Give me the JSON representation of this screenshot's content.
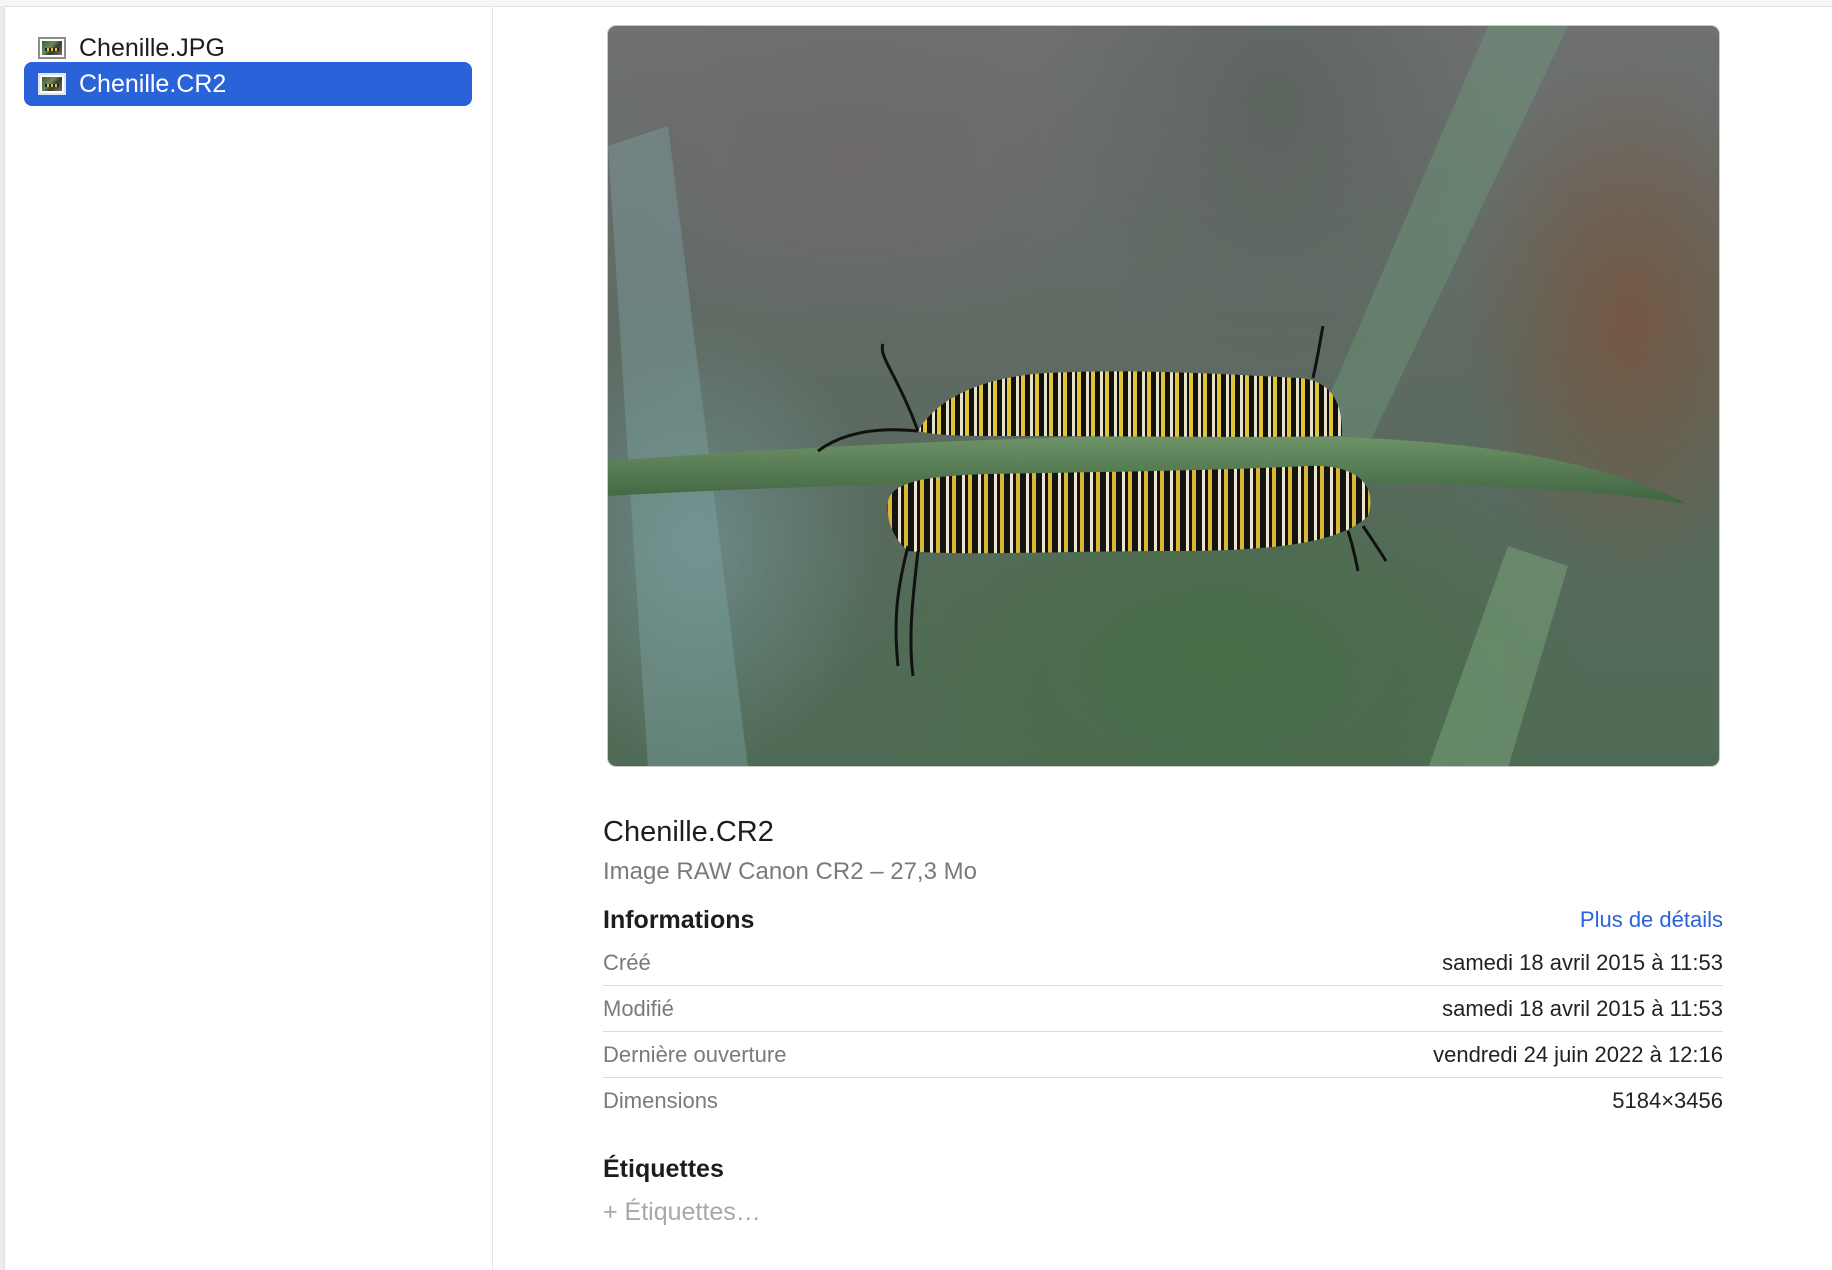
{
  "sidebar": {
    "files": [
      {
        "name": "Chenille.JPG",
        "selected": false,
        "icon": "image-file-icon"
      },
      {
        "name": "Chenille.CR2",
        "selected": true,
        "icon": "image-file-icon"
      }
    ]
  },
  "preview": {
    "file_name": "Chenille.CR2",
    "file_type_size": "Image RAW Canon CR2 – 27,3 Mo"
  },
  "info": {
    "title": "Informations",
    "more_link": "Plus de détails",
    "rows": [
      {
        "label": "Créé",
        "value": "samedi 18 avril 2015 à 11:53"
      },
      {
        "label": "Modifié",
        "value": "samedi 18 avril 2015 à 11:53"
      },
      {
        "label": "Dernière ouverture",
        "value": "vendredi 24 juin 2022 à 12:16"
      },
      {
        "label": "Dimensions",
        "value": "5184×3456"
      }
    ]
  },
  "tags": {
    "title": "Étiquettes",
    "placeholder": "+ Étiquettes…"
  },
  "colors": {
    "selection": "#2a62d9",
    "link": "#2a62d9"
  }
}
